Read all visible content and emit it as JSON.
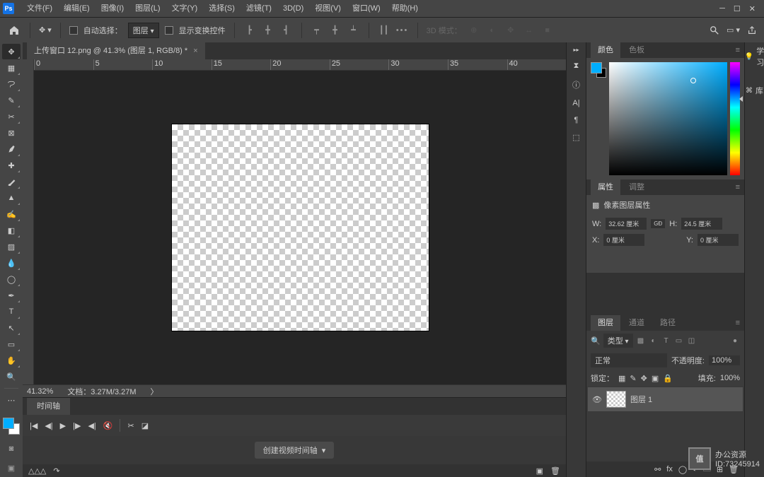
{
  "app": {
    "logo": "Ps"
  },
  "menu": {
    "file": "文件(F)",
    "edit": "编辑(E)",
    "image": "图像(I)",
    "layer": "图层(L)",
    "type": "文字(Y)",
    "select": "选择(S)",
    "filter": "滤镜(T)",
    "threeD": "3D(D)",
    "view": "视图(V)",
    "window": "窗口(W)",
    "help": "帮助(H)"
  },
  "optbar": {
    "auto_select": "自动选择：",
    "target": "图层",
    "show_transform": "显示变换控件",
    "mode3d": "3D 模式："
  },
  "doc": {
    "tab": "上传窗口 12.png @ 41.3% (图层 1, RGB/8) *",
    "zoom": "41.32%",
    "size": "文档：3.27M/3.27M"
  },
  "ruler_ticks": [
    "0",
    "5",
    "10",
    "15",
    "20",
    "25",
    "30",
    "35",
    "40"
  ],
  "timeline": {
    "tab": "时间轴",
    "create_btn": "创建视频时间轴",
    "slider": "△△△"
  },
  "panels": {
    "color_tab": "颜色",
    "swatch_tab": "色板",
    "prop_tab": "属性",
    "adjust_tab": "调整",
    "prop_title": "像素图层属性",
    "w_label": "W:",
    "w_val": "32.62 厘米",
    "link": "GĐ",
    "h_label": "H:",
    "h_val": "24.5 厘米",
    "x_label": "X:",
    "x_val": "0 厘米",
    "y_label": "Y:",
    "y_val": "0 厘米",
    "layers_tab": "图层",
    "channels_tab": "通道",
    "paths_tab": "路径",
    "kind": "类型",
    "blend": "正常",
    "opacity_lbl": "不透明度:",
    "opacity": "100%",
    "lock_lbl": "锁定：",
    "fill_lbl": "填充:",
    "fill": "100%",
    "layer1": "图层 1"
  },
  "learn": {
    "label": "学习",
    "library": "库"
  },
  "watermark": {
    "name": "办公资源",
    "id": "ID:73245914",
    "logo": "值"
  }
}
